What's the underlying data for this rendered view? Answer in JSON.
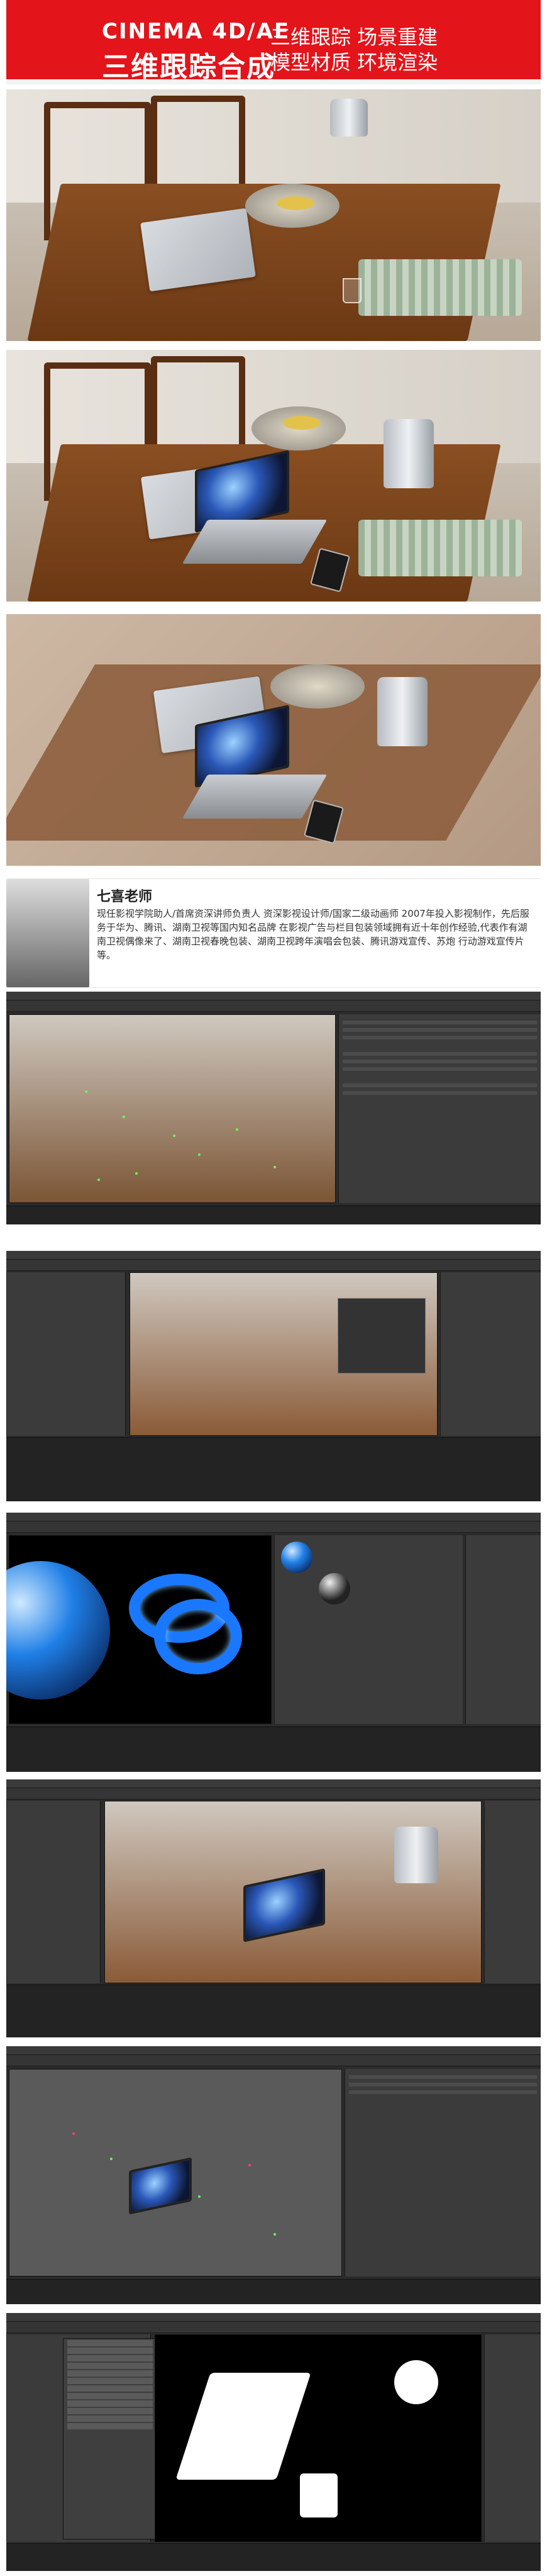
{
  "banner": {
    "line1": "CINEMA 4D/AE",
    "line2": "三维跟踪合成",
    "right1": "三维跟踪 场景重建",
    "right2": "模型材质 环境渲染"
  },
  "teacher": {
    "name": "七喜老师",
    "bio": "现任影视学院助人/首席资深讲师负责人 资深影视设计师/国家二级动画师 2007年投入影视制作，先后服务于华为、腾讯、湖南卫视等国内知名品牌 在影视广告与栏目包装领域拥有近十年创作经验,代表作有湖南卫视偶像来了、湖南卫视春晚包装、湖南卫视跨年演唱会包装、腾讯游戏宣传、苏炮 行动游戏宣传片等。"
  }
}
